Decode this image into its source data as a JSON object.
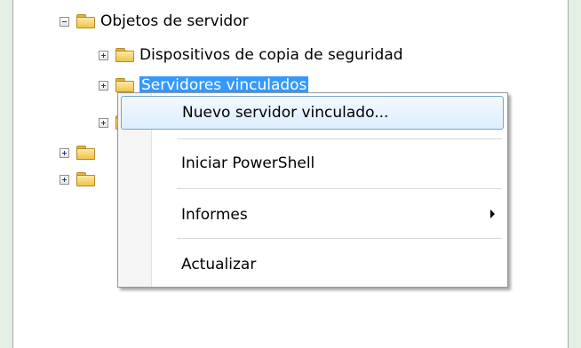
{
  "tree": {
    "root": {
      "label": "Objetos de servidor",
      "expanded": true
    },
    "children": [
      {
        "label": "Dispositivos de copia de seguridad",
        "expanded": false
      },
      {
        "label": "Servidores vinculados",
        "expanded": false,
        "selected": true
      },
      {
        "label": "",
        "expanded": false
      }
    ],
    "siblings": [
      {
        "label": "",
        "expanded": false
      },
      {
        "label": "",
        "expanded": false
      }
    ]
  },
  "context_menu": {
    "items": [
      {
        "label": "Nuevo servidor vinculado...",
        "highlighted": true
      },
      {
        "label": "Iniciar PowerShell"
      },
      {
        "label": "Informes",
        "has_submenu": true
      },
      {
        "label": "Actualizar"
      }
    ]
  },
  "colors": {
    "background": "#e3f0e3",
    "selection": "#3399ff",
    "highlight_border": "#7da2ce",
    "folder": "#f0c24b"
  }
}
